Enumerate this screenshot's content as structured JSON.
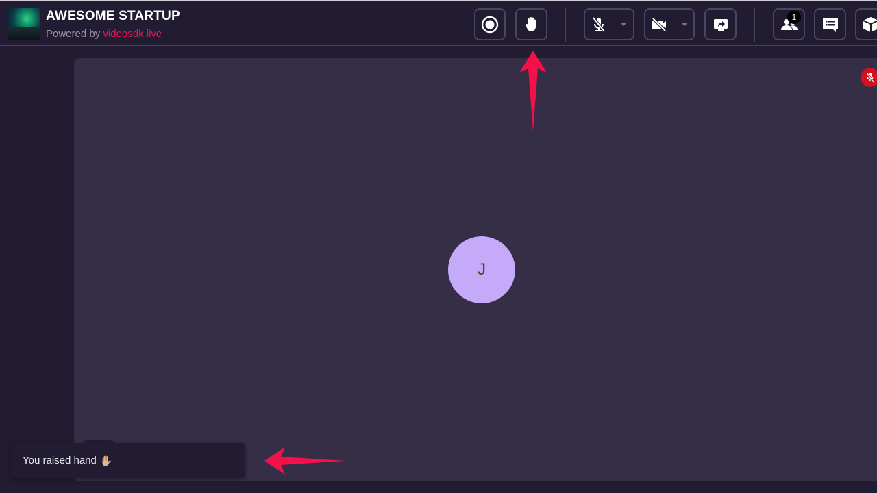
{
  "header": {
    "title": "AWESOME STARTUP",
    "powered_by_prefix": "Powered by",
    "powered_by_link": "videosdk.live"
  },
  "toolbar": {
    "buttons": [
      {
        "name": "record",
        "icon": "record-icon"
      },
      {
        "name": "raise-hand",
        "icon": "raise-hand-icon"
      },
      {
        "name": "mic",
        "icon": "mic-off-icon",
        "has_dropdown": true
      },
      {
        "name": "webcam",
        "icon": "video-off-icon",
        "has_dropdown": true
      },
      {
        "name": "screen-share",
        "icon": "screen-share-icon"
      },
      {
        "name": "participants",
        "icon": "participants-icon",
        "badge": "1"
      },
      {
        "name": "chat",
        "icon": "chat-icon"
      },
      {
        "name": "more",
        "icon": "cube-icon"
      }
    ],
    "participants_badge": "1"
  },
  "stage": {
    "participant_initial": "J",
    "mic_status": "muted"
  },
  "toast": {
    "message": "You raised hand",
    "emoji": "✋🏼"
  },
  "colors": {
    "background": "#221c33",
    "tile": "#362e47",
    "avatar": "#c4aaf8",
    "accent_link": "#f0114f",
    "muted_indicator": "#d0121f",
    "annotation_arrow": "#f5104a"
  }
}
